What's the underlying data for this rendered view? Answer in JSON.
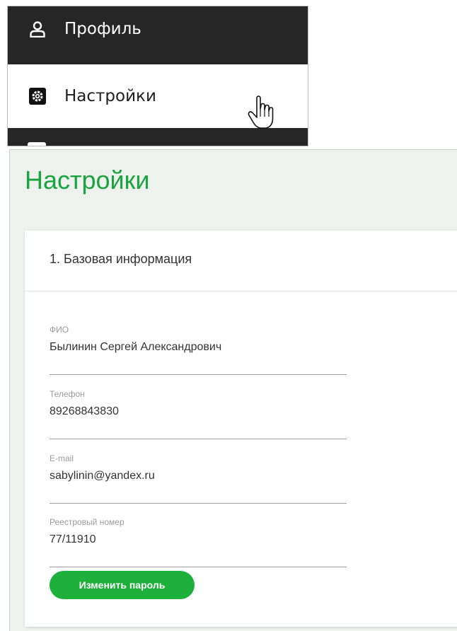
{
  "menu": {
    "items": [
      {
        "label": "Профиль",
        "icon": "user-icon",
        "state": "default"
      },
      {
        "label": "Настройки",
        "icon": "gear-icon",
        "state": "hover"
      }
    ]
  },
  "page": {
    "title": "Настройки"
  },
  "basic_info": {
    "section_title": "1. Базовая информация",
    "fields": [
      {
        "label": "ФИО",
        "value": "Былинин Сергей Александрович"
      },
      {
        "label": "Телефон",
        "value": "89268843830"
      },
      {
        "label": "E-mail",
        "value": "sabylinin@yandex.ru"
      },
      {
        "label": "Реестровый номер",
        "value": "77/11910"
      }
    ],
    "change_password_label": "Изменить пароль"
  },
  "colors": {
    "accent_green": "#1db13c",
    "title_green": "#1aa33e",
    "menu_dark": "#262626",
    "page_bg": "#eef2ee"
  }
}
